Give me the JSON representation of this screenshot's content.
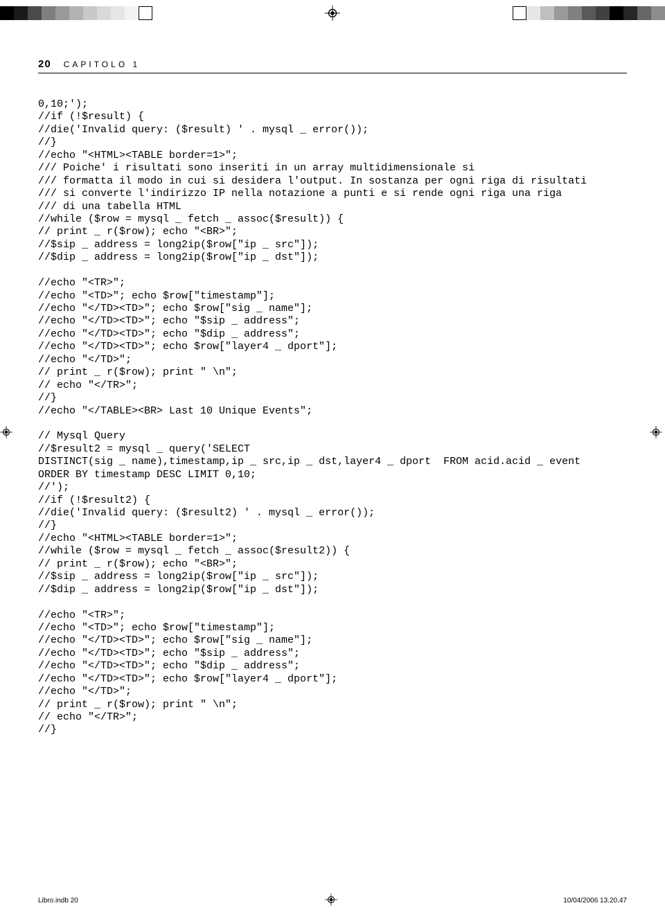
{
  "meta": {
    "footer_left": "Libro.indb   20",
    "footer_right": "10/04/2006   13.20.47"
  },
  "header": {
    "page_number": "20",
    "chapter": "CAPITOLO 1"
  },
  "regblocks_left": [
    "#000000",
    "#1a1a1a",
    "#4a4a4a",
    "#7f7f7f",
    "#9a9a9a",
    "#b3b3b3",
    "#c9c9c9",
    "#d9d9d9",
    "#e6e6e6",
    "#f2f2f2",
    "#ffffff"
  ],
  "regblocks_right": [
    "#ffffff",
    "#e6e6e6",
    "#bfbfbf",
    "#999999",
    "#808080",
    "#595959",
    "#404040",
    "#000000",
    "#262626",
    "#666666",
    "#8c8c8c"
  ],
  "code": "0,10;');\n//if (!$result) {\n//die('Invalid query: ($result) ' . mysql _ error());\n//}\n//echo \"<HTML><TABLE border=1>\";\n/// Poiche' i risultati sono inseriti in un array multidimensionale si\n/// formatta il modo in cui si desidera l'output. In sostanza per ogni riga di risultati\n/// si converte l'indirizzo IP nella notazione a punti e si rende ogni riga una riga\n/// di una tabella HTML\n//while ($row = mysql _ fetch _ assoc($result)) {\n// print _ r($row); echo \"<BR>\";\n//$sip _ address = long2ip($row[\"ip _ src\"]);\n//$dip _ address = long2ip($row[\"ip _ dst\"]);\n\n//echo \"<TR>\";\n//echo \"<TD>\"; echo $row[\"timestamp\"];\n//echo \"</TD><TD>\"; echo $row[\"sig _ name\"];\n//echo \"</TD><TD>\"; echo \"$sip _ address\";\n//echo \"</TD><TD>\"; echo \"$dip _ address\";\n//echo \"</TD><TD>\"; echo $row[\"layer4 _ dport\"];\n//echo \"</TD>\";\n// print _ r($row); print \" \\n\";\n// echo \"</TR>\";\n//}\n//echo \"</TABLE><BR> Last 10 Unique Events\";\n\n// Mysql Query\n//$result2 = mysql _ query('SELECT\nDISTINCT(sig _ name),timestamp,ip _ src,ip _ dst,layer4 _ dport  FROM acid.acid _ event\nORDER BY timestamp DESC LIMIT 0,10;\n//');\n//if (!$result2) {\n//die('Invalid query: ($result2) ' . mysql _ error());\n//}\n//echo \"<HTML><TABLE border=1>\";\n//while ($row = mysql _ fetch _ assoc($result2)) {\n// print _ r($row); echo \"<BR>\";\n//$sip _ address = long2ip($row[\"ip _ src\"]);\n//$dip _ address = long2ip($row[\"ip _ dst\"]);\n\n//echo \"<TR>\";\n//echo \"<TD>\"; echo $row[\"timestamp\"];\n//echo \"</TD><TD>\"; echo $row[\"sig _ name\"];\n//echo \"</TD><TD>\"; echo \"$sip _ address\";\n//echo \"</TD><TD>\"; echo \"$dip _ address\";\n//echo \"</TD><TD>\"; echo $row[\"layer4 _ dport\"];\n//echo \"</TD>\";\n// print _ r($row); print \" \\n\";\n// echo \"</TR>\";\n//}"
}
